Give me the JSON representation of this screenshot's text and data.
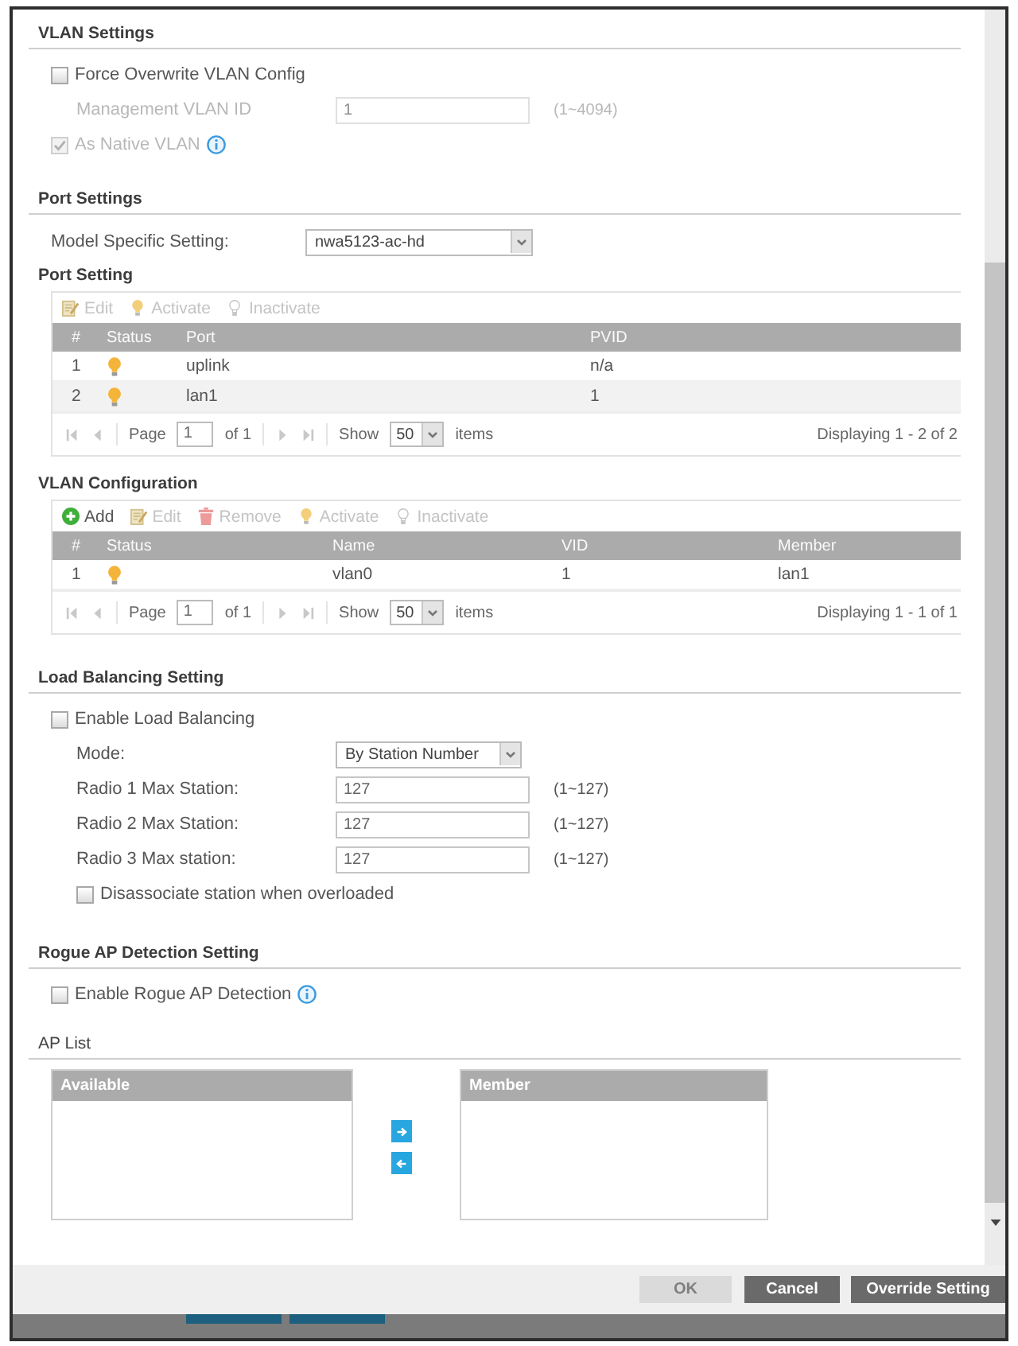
{
  "vlan_settings": {
    "title": "VLAN Settings",
    "force_overwrite": {
      "label": "Force Overwrite VLAN Config",
      "checked": false
    },
    "management_vlan_id": {
      "label": "Management VLAN ID",
      "value": "1",
      "range": "(1~4094)",
      "disabled": true
    },
    "as_native_vlan": {
      "label": "As Native VLAN",
      "checked": true,
      "disabled": true
    }
  },
  "port_settings": {
    "title": "Port Settings",
    "model_specific_setting": {
      "label": "Model Specific Setting:",
      "value": "nwa5123-ac-hd"
    }
  },
  "port_setting": {
    "title": "Port Setting",
    "toolbar": [
      {
        "kind": "edit",
        "label": "Edit",
        "disabled": true
      },
      {
        "kind": "activate",
        "label": "Activate",
        "disabled": true
      },
      {
        "kind": "inactivate",
        "label": "Inactivate",
        "disabled": true
      }
    ],
    "columns": [
      "#",
      "Status",
      "Port",
      "PVID"
    ],
    "rows": [
      {
        "cells": [
          {
            "kind": "text",
            "text": "1"
          },
          {
            "kind": "status",
            "active": true
          },
          {
            "kind": "text",
            "text": "uplink"
          },
          {
            "kind": "text",
            "text": "n/a"
          }
        ]
      },
      {
        "cells": [
          {
            "kind": "text",
            "text": "2"
          },
          {
            "kind": "status",
            "active": true
          },
          {
            "kind": "text",
            "text": "lan1"
          },
          {
            "kind": "text",
            "text": "1"
          }
        ]
      }
    ],
    "pager": {
      "page_label": "Page",
      "page": "1",
      "of": "of 1",
      "show_label": "Show",
      "per_page": "50",
      "items_label": "items",
      "summary": "Displaying 1 - 2 of 2"
    }
  },
  "vlan_configuration": {
    "title": "VLAN Configuration",
    "toolbar": [
      {
        "kind": "add",
        "label": "Add",
        "disabled": false
      },
      {
        "kind": "edit",
        "label": "Edit",
        "disabled": true
      },
      {
        "kind": "remove",
        "label": "Remove",
        "disabled": true
      },
      {
        "kind": "activate",
        "label": "Activate",
        "disabled": true
      },
      {
        "kind": "inactivate",
        "label": "Inactivate",
        "disabled": true
      }
    ],
    "columns": [
      "#",
      "Status",
      "Name",
      "VID",
      "Member"
    ],
    "rows": [
      {
        "cells": [
          {
            "kind": "text",
            "text": "1"
          },
          {
            "kind": "status",
            "active": true
          },
          {
            "kind": "text",
            "text": "vlan0"
          },
          {
            "kind": "text",
            "text": "1"
          },
          {
            "kind": "text",
            "text": "lan1"
          }
        ]
      }
    ],
    "pager": {
      "page_label": "Page",
      "page": "1",
      "of": "of 1",
      "show_label": "Show",
      "per_page": "50",
      "items_label": "items",
      "summary": "Displaying 1 - 1 of 1"
    }
  },
  "load_balancing": {
    "title": "Load Balancing Setting",
    "enable": {
      "label": "Enable Load Balancing",
      "checked": false
    },
    "mode": {
      "label": "Mode:",
      "value": "By Station Number"
    },
    "radios": [
      {
        "label": "Radio 1 Max Station:",
        "value": "127",
        "range": "(1~127)"
      },
      {
        "label": "Radio 2 Max Station:",
        "value": "127",
        "range": "(1~127)"
      },
      {
        "label": "Radio 3 Max station:",
        "value": "127",
        "range": "(1~127)"
      }
    ],
    "disassociate": {
      "label": "Disassociate station when overloaded",
      "checked": false
    }
  },
  "rogue_ap_detection": {
    "title": "Rogue AP Detection Setting",
    "enable": {
      "label": "Enable Rogue AP Detection",
      "checked": false
    }
  },
  "ap_list": {
    "title": "AP List",
    "available": {
      "header": "Available"
    },
    "member": {
      "header": "Member"
    }
  },
  "footer": {
    "buttons": [
      {
        "label": "OK",
        "disabled": true
      },
      {
        "label": "Cancel",
        "disabled": false
      },
      {
        "label": "Override Setting",
        "disabled": false
      }
    ]
  }
}
